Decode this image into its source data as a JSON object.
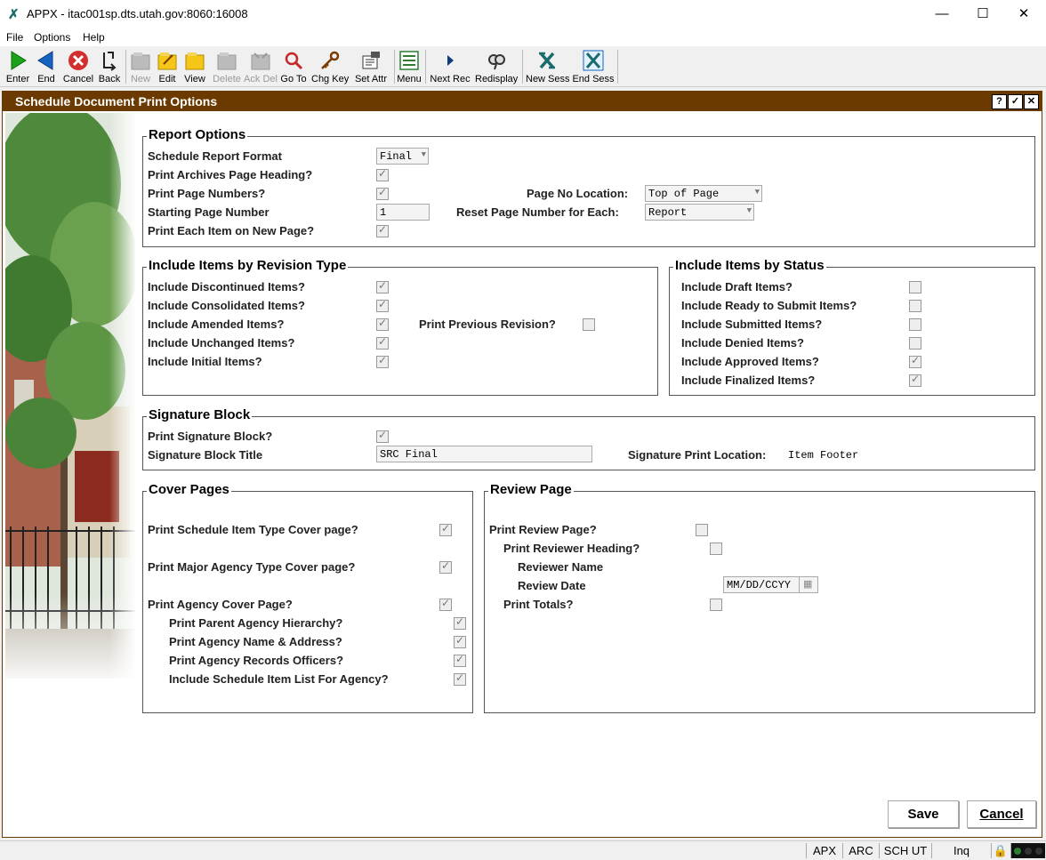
{
  "window": {
    "title": "APPX - itac001sp.dts.utah.gov:8060:16008",
    "minimize": "—",
    "maximize": "☐",
    "close": "✕"
  },
  "menu": {
    "items": [
      "File",
      "Options",
      "Help"
    ]
  },
  "toolbar": {
    "buttons": [
      {
        "label": "Enter",
        "icon": "enter-icon"
      },
      {
        "label": "End",
        "icon": "end-icon"
      },
      {
        "label": "Cancel",
        "icon": "cancel-icon"
      },
      {
        "label": "Back",
        "icon": "back-icon"
      },
      {
        "label": "New",
        "icon": "new-icon"
      },
      {
        "label": "Edit",
        "icon": "edit-icon"
      },
      {
        "label": "View",
        "icon": "view-icon"
      },
      {
        "label": "Delete",
        "icon": "delete-icon"
      },
      {
        "label": "Ack Del",
        "icon": "ack-del-icon"
      },
      {
        "label": "Go To",
        "icon": "goto-icon"
      },
      {
        "label": "Chg Key",
        "icon": "key-icon"
      },
      {
        "label": "Set Attr",
        "icon": "set-attr-icon"
      },
      {
        "label": "Menu",
        "icon": "menu-icon"
      },
      {
        "label": "Next Rec",
        "icon": "next-rec-icon"
      },
      {
        "label": "Redisplay",
        "icon": "redisplay-icon"
      },
      {
        "label": "New Sess",
        "icon": "new-sess-icon"
      },
      {
        "label": "End Sess",
        "icon": "end-sess-icon"
      }
    ]
  },
  "header": {
    "title": "Schedule Document Print Options",
    "help": "?",
    "ok": "✓",
    "close": "✕"
  },
  "report_options": {
    "title": "Report Options",
    "format_label": "Schedule Report Format",
    "format_value": "Final",
    "archives_label": "Print Archives Page Heading?",
    "page_numbers_label": "Print Page Numbers?",
    "page_no_location_label": "Page No Location:",
    "page_no_location_value": "Top of Page",
    "starting_page_label": "Starting Page Number",
    "starting_page_value": "1",
    "reset_label": "Reset Page Number for Each:",
    "reset_value": "Report",
    "each_item_label": "Print Each Item on New Page?"
  },
  "revision": {
    "title": "Include Items by Revision Type",
    "discontinued": "Include Discontinued Items?",
    "consolidated": "Include Consolidated Items?",
    "amended": "Include Amended Items?",
    "unchanged": "Include Unchanged Items?",
    "initial": "Include Initial Items?",
    "previous": "Print Previous Revision?"
  },
  "status": {
    "title": "Include Items by Status",
    "draft": "Include Draft Items?",
    "ready": "Include Ready to Submit Items?",
    "submitted": "Include Submitted Items?",
    "denied": "Include Denied Items?",
    "approved": "Include Approved Items?",
    "finalized": "Include Finalized Items?"
  },
  "signature": {
    "title": "Signature Block",
    "print_label": "Print Signature Block?",
    "title_label": "Signature Block Title",
    "title_value": "SRC Final",
    "location_label": "Signature Print Location:",
    "location_value": "Item Footer"
  },
  "cover": {
    "title": "Cover Pages",
    "item_type": "Print Schedule Item Type Cover page?",
    "major_agency": "Print Major Agency Type Cover page?",
    "agency_cover": "Print Agency Cover Page?",
    "parent_hierarchy": "Print Parent Agency Hierarchy?",
    "name_address": "Print Agency Name & Address?",
    "records_officers": "Print Agency Records Officers?",
    "item_list": "Include Schedule Item List For Agency?"
  },
  "review": {
    "title": "Review Page",
    "print_review": "Print Review Page?",
    "reviewer_heading": "Print Reviewer Heading?",
    "reviewer_name": "Reviewer Name",
    "review_date": "Review Date",
    "review_date_value": "MM/DD/CCYY",
    "totals": "Print Totals?"
  },
  "actions": {
    "save": "Save",
    "cancel": "Cancel"
  },
  "statusbar": {
    "items": [
      "APX",
      "ARC",
      "SCH UT",
      "Inq"
    ]
  },
  "colors": {
    "header": "#6b3a00",
    "enter": "#1aa31a",
    "end": "#1565c0",
    "cancel": "#d32f2f"
  }
}
